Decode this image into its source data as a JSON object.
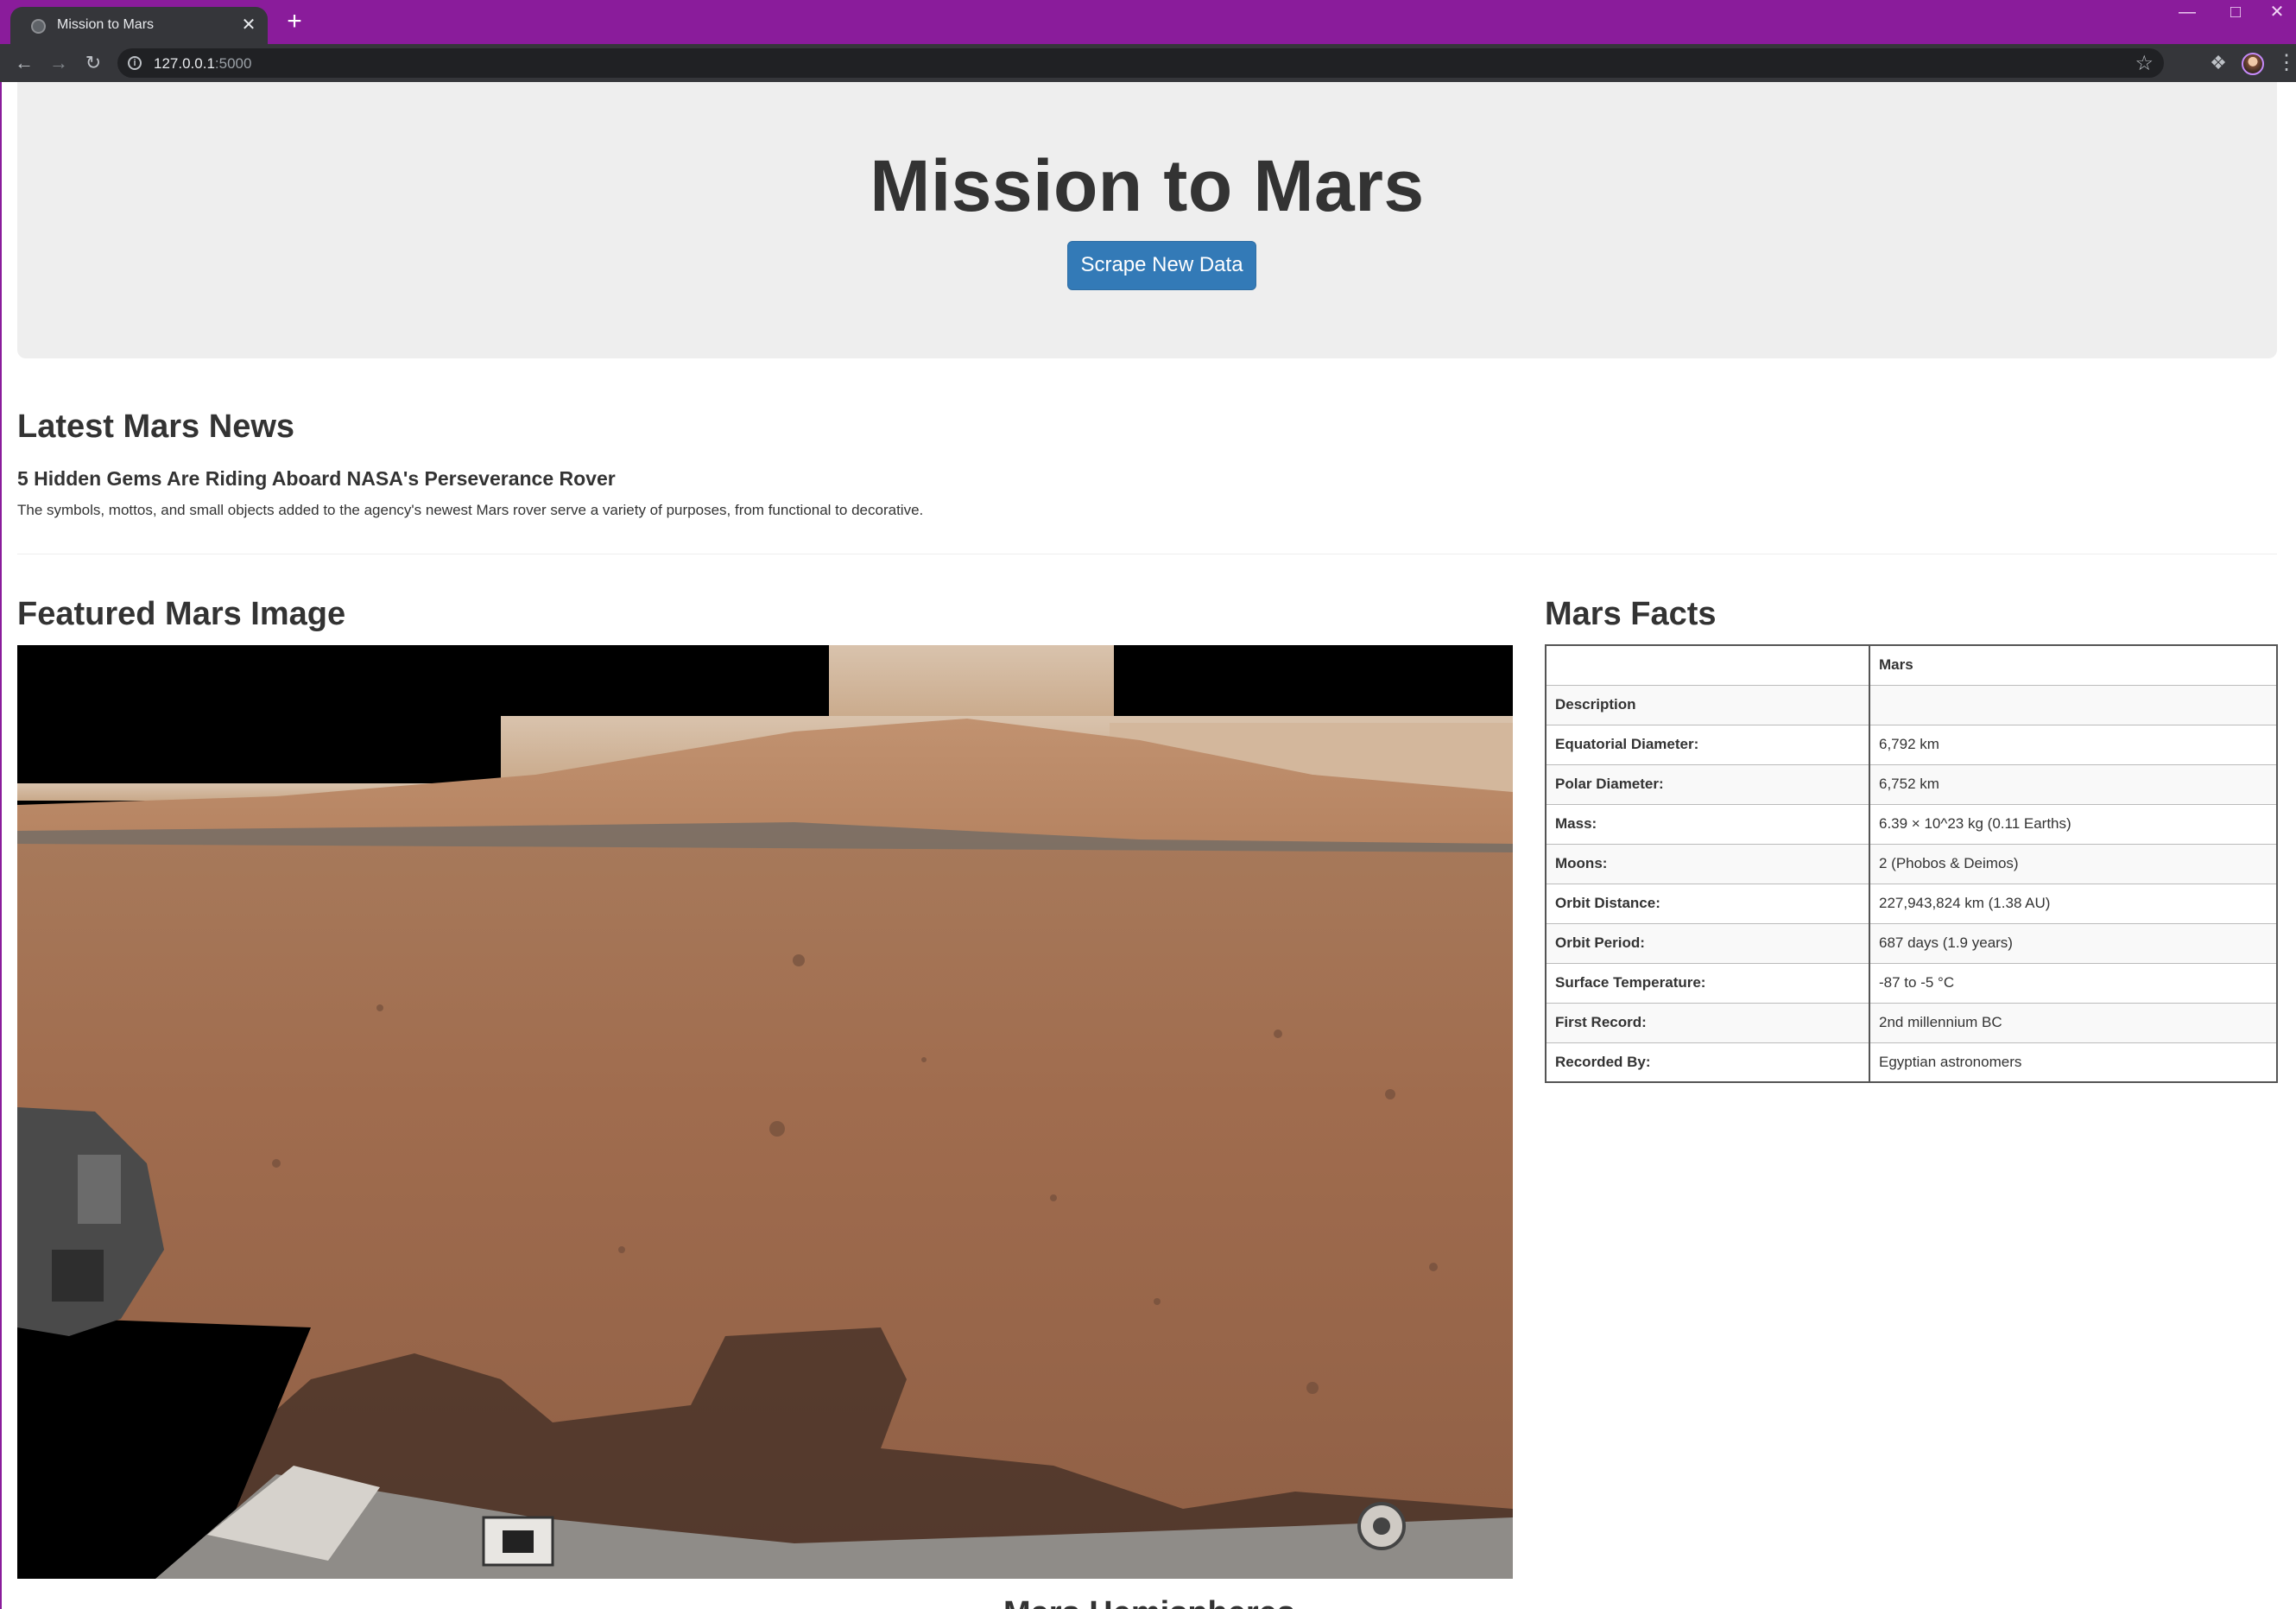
{
  "browser": {
    "tab_title": "Mission to Mars",
    "url_host": "127.0.0.1",
    "url_port": ":5000",
    "window_min": "—",
    "window_max": "□",
    "window_close": "✕",
    "tab_close": "✕",
    "new_tab": "+",
    "icons": [
      "globe-icon",
      "close-icon",
      "plus-icon",
      "back-icon",
      "forward-icon",
      "reload-icon",
      "info-icon",
      "star-icon",
      "puzzle-icon",
      "avatar",
      "kebab-menu-icon"
    ]
  },
  "jumbotron": {
    "title": "Mission to Mars",
    "button_label": "Scrape New Data"
  },
  "news": {
    "heading": "Latest Mars News",
    "title": "5 Hidden Gems Are Riding Aboard NASA's Perseverance Rover",
    "teaser": "The symbols, mottos, and small objects added to the agency's newest Mars rover serve a variety of purposes, from functional to decorative."
  },
  "featured_image": {
    "heading": "Featured Mars Image"
  },
  "facts": {
    "heading": "Mars Facts",
    "header": [
      "",
      "Mars"
    ],
    "rows": [
      [
        "Description",
        ""
      ],
      [
        "Equatorial Diameter:",
        "6,792 km"
      ],
      [
        "Polar Diameter:",
        "6,752 km"
      ],
      [
        "Mass:",
        "6.39 × 10^23 kg (0.11 Earths)"
      ],
      [
        "Moons:",
        "2 (Phobos & Deimos)"
      ],
      [
        "Orbit Distance:",
        "227,943,824 km (1.38 AU)"
      ],
      [
        "Orbit Period:",
        "687 days (1.9 years)"
      ],
      [
        "Surface Temperature:",
        "-87 to -5 °C"
      ],
      [
        "First Record:",
        "2nd millennium BC"
      ],
      [
        "Recorded By:",
        "Egyptian astronomers"
      ]
    ]
  },
  "hemispheres": {
    "heading_peek": "Mars Hemispheres"
  },
  "colors": {
    "titlebar": "#8a1c9b",
    "button": "#337ab7",
    "jumbotron": "#eeeeee"
  }
}
